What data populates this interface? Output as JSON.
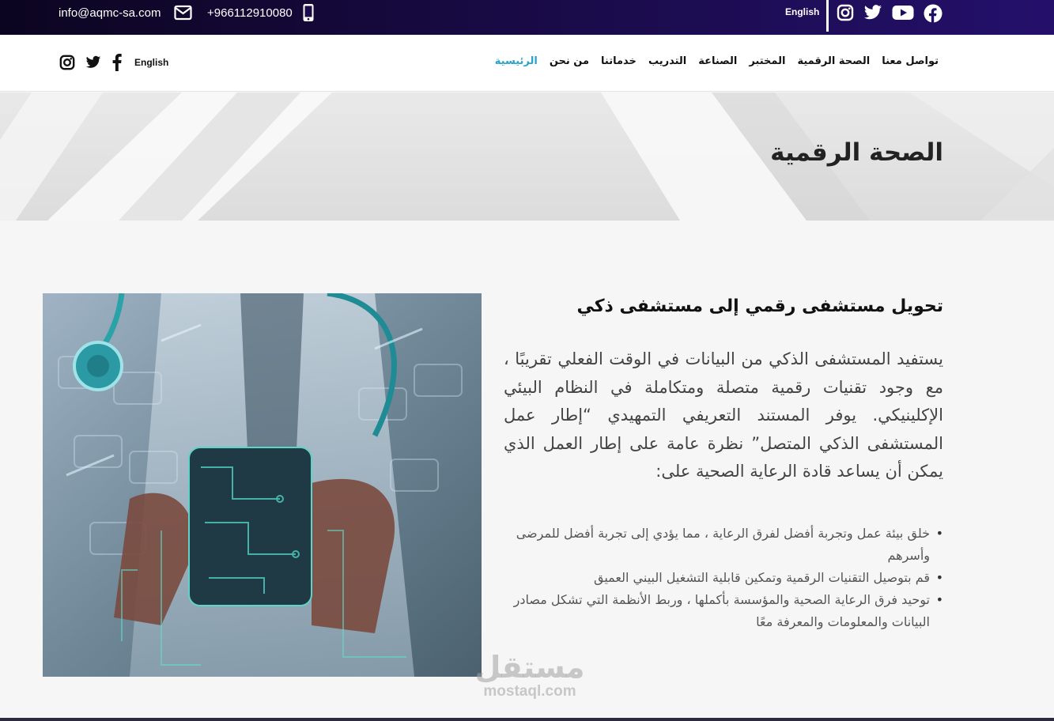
{
  "topbar": {
    "email": "info@aqmc-sa.com",
    "phone": "+966112910080",
    "language": "English",
    "social_icons": [
      "instagram-icon",
      "twitter-icon",
      "youtube-icon",
      "facebook-icon"
    ]
  },
  "nav": {
    "language": "English",
    "social_icons": [
      "instagram-icon",
      "twitter-icon",
      "facebook-icon"
    ],
    "links": [
      "الرئيسية",
      "من نحن",
      "خدماتنا",
      "التدريب",
      "الصناعة",
      "المختبر",
      "الصحة الرقمية",
      "تواصل معنا"
    ],
    "active_link": "الرئيسية"
  },
  "hero": {
    "title": "الصحة الرقمية"
  },
  "main": {
    "heading": "تحويل مستشفى رقمي إلى مستشفى ذكي",
    "intro": "يستفيد المستشفى الذكي من البيانات في الوقت الفعلي تقريبًا ، مع وجود تقنيات رقمية متصلة ومتكاملة في النظام البيئي الإكلينيكي. يوفر المستند التعريفي التمهيدي “إطار عمل المستشفى الذكي المتصل” نظرة عامة على إطار العمل الذي يمكن أن يساعد قادة الرعاية الصحية على:",
    "bullets": [
      "خلق بيئة عمل وتجربة أفضل لفرق الرعاية ، مما يؤدي إلى تجربة أفضل للمرضى وأسرهم",
      "قم بتوصيل التقنيات الرقمية وتمكين قابلية التشغيل البيني العميق",
      "توحيد فرق الرعاية الصحية والمؤسسة بأكملها ، وربط الأنظمة التي تشكل مصادر البيانات والمعلومات والمعرفة معًا"
    ]
  },
  "watermark": {
    "arabic": "مستقل",
    "latin": "mostaql.com"
  },
  "colors": {
    "topbar": "#1a0b4a",
    "accent": "#2aa3c9",
    "text": "#222222"
  }
}
